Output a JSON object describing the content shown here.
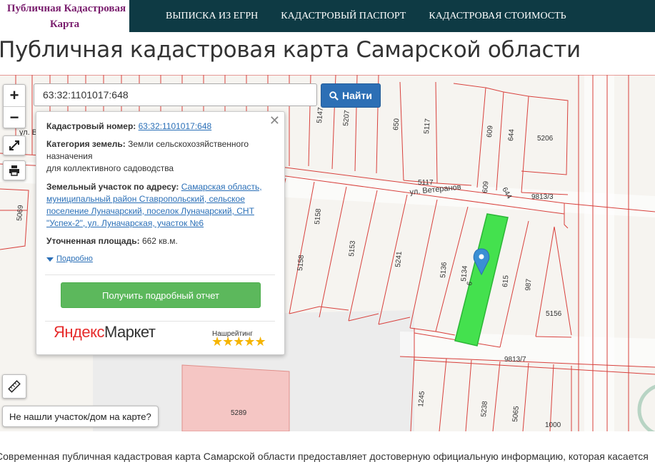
{
  "header": {
    "logo_line1": "Публичная Кадастровая",
    "logo_line2": "Карта",
    "nav": [
      "ВЫПИСКА ИЗ ЕГРН",
      "КАДАСТРОВЫЙ ПАСПОРТ",
      "КАДАСТРОВАЯ СТОИМОСТЬ"
    ]
  },
  "page_title": "Публичная кадастровая карта Самарской области",
  "map": {
    "search": {
      "value": "63:32:1101017:648",
      "button": "Найти"
    },
    "zoom_in": "+",
    "zoom_out": "−",
    "street_veteranov": "ул. Ветеранов",
    "street_partial": "ул. В",
    "plot_labels": [
      "5147",
      "5207",
      "650",
      "5117",
      "609",
      "644",
      "5206",
      "5117",
      "609",
      "644",
      "9813/3",
      "5069",
      "5158",
      "5153",
      "5241",
      "5136",
      "5134",
      "615",
      "987",
      "5156",
      "9813/7",
      "1245",
      "5238",
      "5065",
      "1000",
      "5289",
      "6"
    ],
    "not_found_button": "Не нашли участок/дом на карте?"
  },
  "popup": {
    "cad_label": "Кадастровый номер:",
    "cad_value": "63:32:1101017:648",
    "category_label": "Категория земель:",
    "category_value_1": "Земли сельскохозяйственного",
    "category_value_2": "назначения",
    "category_value_3": "для коллективного садоводства",
    "address_label": "Земельный участок по адресу:",
    "address_l1": "Самарская область,",
    "address_l2": "муниципальный район Ставропольский, сельское",
    "address_l3": "поселение Луначарский, поселок Луначарский, СНТ",
    "address_l4": "\"Успех-2\", ул. Луначарская, участок №6",
    "area_label": "Уточненная площадь:",
    "area_value": "662 кв.м.",
    "more": "Подробно",
    "report_button": "Получить подробный отчет",
    "market_y": "Яндекс",
    "market_rest": "Маркет",
    "rating_label": "Нашрейтинг",
    "stars": "★★★★★"
  },
  "bottom_text": "Современная публичная кадастровая карта Самарской области предоставляет достоверную официальную информацию, которая касается"
}
